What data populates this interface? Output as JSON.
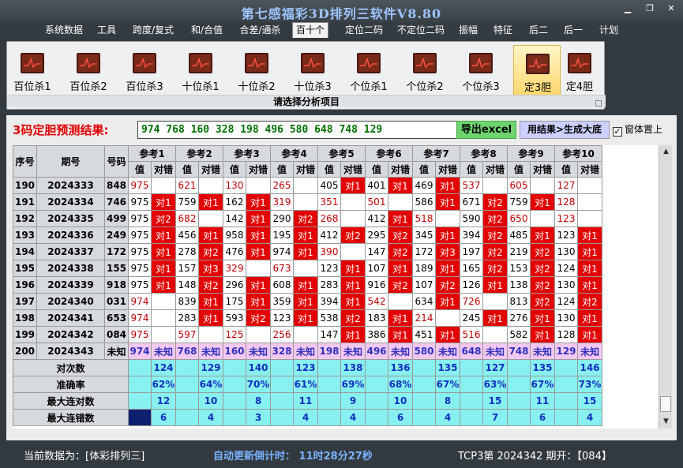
{
  "app": {
    "title": "第七感福彩3D排列三软件V8.80"
  },
  "menu": [
    "系统数据",
    "工具",
    "跨度/复式",
    "和/合值",
    "合差/通杀",
    "百十个",
    "定位二码",
    "不定位二码",
    "振幅",
    "特征",
    "后二",
    "后一",
    "计划"
  ],
  "menu_active": 5,
  "ribbon": {
    "buttons": [
      "百位杀1",
      "百位杀2",
      "百位杀3",
      "十位杀1",
      "十位杀2",
      "十位杀3",
      "个位杀1",
      "个位杀2",
      "个位杀3",
      "定3胆",
      "定4胆"
    ],
    "active": 9,
    "caption": "请选择分析项目"
  },
  "result": {
    "label": "3码定胆预测结果:",
    "value": "974  768  160  328  198  496  580  648  748  129",
    "export_label": "导出excel",
    "tobig_label": "用结果>生成大底",
    "ontop_label": "窗体置上",
    "ontop_checked": "✓"
  },
  "table": {
    "headers": {
      "seq": "序号",
      "period": "期号",
      "code": "号码",
      "ref": [
        "参考1",
        "参考2",
        "参考3",
        "参考4",
        "参考5",
        "参考6",
        "参考7",
        "参考8",
        "参考9",
        "参考10"
      ],
      "val": "值",
      "ok": "对错"
    },
    "rows": [
      {
        "seq": "190",
        "period": "2024333",
        "code": "848",
        "cells": [
          [
            "975",
            ""
          ],
          [
            "621",
            ""
          ],
          [
            "130",
            ""
          ],
          [
            "265",
            ""
          ],
          [
            "405",
            "对1"
          ],
          [
            "401",
            "对1"
          ],
          [
            "469",
            "对1"
          ],
          [
            "537",
            ""
          ],
          [
            "605",
            ""
          ],
          [
            "127",
            ""
          ]
        ]
      },
      {
        "seq": "191",
        "period": "2024334",
        "code": "746",
        "cells": [
          [
            "975",
            "对1"
          ],
          [
            "759",
            "对1"
          ],
          [
            "162",
            "对1"
          ],
          [
            "319",
            ""
          ],
          [
            "351",
            ""
          ],
          [
            "501",
            ""
          ],
          [
            "586",
            "对1"
          ],
          [
            "671",
            "对2"
          ],
          [
            "759",
            "对1"
          ],
          [
            "128",
            ""
          ]
        ]
      },
      {
        "seq": "192",
        "period": "2024335",
        "code": "499",
        "cells": [
          [
            "975",
            "对2"
          ],
          [
            "682",
            ""
          ],
          [
            "142",
            "对1"
          ],
          [
            "290",
            "对2"
          ],
          [
            "268",
            ""
          ],
          [
            "412",
            "对1"
          ],
          [
            "518",
            ""
          ],
          [
            "590",
            "对2"
          ],
          [
            "650",
            ""
          ],
          [
            "123",
            ""
          ]
        ]
      },
      {
        "seq": "193",
        "period": "2024336",
        "code": "249",
        "cells": [
          [
            "975",
            "对1"
          ],
          [
            "456",
            "对1"
          ],
          [
            "958",
            "对1"
          ],
          [
            "195",
            "对1"
          ],
          [
            "412",
            "对2"
          ],
          [
            "295",
            "对2"
          ],
          [
            "345",
            "对1"
          ],
          [
            "394",
            "对2"
          ],
          [
            "485",
            "对1"
          ],
          [
            "123",
            "对1"
          ]
        ]
      },
      {
        "seq": "194",
        "period": "2024337",
        "code": "172",
        "cells": [
          [
            "975",
            "对1"
          ],
          [
            "278",
            "对2"
          ],
          [
            "476",
            "对1"
          ],
          [
            "974",
            "对1"
          ],
          [
            "390",
            ""
          ],
          [
            "147",
            "对2"
          ],
          [
            "172",
            "对3"
          ],
          [
            "197",
            "对2"
          ],
          [
            "219",
            "对2"
          ],
          [
            "130",
            "对1"
          ]
        ]
      },
      {
        "seq": "195",
        "period": "2024338",
        "code": "155",
        "cells": [
          [
            "975",
            "对1"
          ],
          [
            "157",
            "对3"
          ],
          [
            "329",
            ""
          ],
          [
            "673",
            ""
          ],
          [
            "123",
            "对1"
          ],
          [
            "107",
            "对1"
          ],
          [
            "189",
            "对1"
          ],
          [
            "165",
            "对2"
          ],
          [
            "153",
            "对2"
          ],
          [
            "124",
            "对1"
          ]
        ]
      },
      {
        "seq": "196",
        "period": "2024339",
        "code": "918",
        "cells": [
          [
            "975",
            "对1"
          ],
          [
            "148",
            "对2"
          ],
          [
            "296",
            "对1"
          ],
          [
            "608",
            "对1"
          ],
          [
            "283",
            "对1"
          ],
          [
            "916",
            "对2"
          ],
          [
            "107",
            "对2"
          ],
          [
            "126",
            "对1"
          ],
          [
            "138",
            "对2"
          ],
          [
            "130",
            "对1"
          ]
        ]
      },
      {
        "seq": "197",
        "period": "2024340",
        "code": "031",
        "cells": [
          [
            "974",
            ""
          ],
          [
            "839",
            "对1"
          ],
          [
            "175",
            "对1"
          ],
          [
            "359",
            "对1"
          ],
          [
            "394",
            "对1"
          ],
          [
            "542",
            ""
          ],
          [
            "634",
            "对1"
          ],
          [
            "726",
            ""
          ],
          [
            "813",
            "对2"
          ],
          [
            "124",
            "对2"
          ]
        ]
      },
      {
        "seq": "198",
        "period": "2024341",
        "code": "653",
        "cells": [
          [
            "974",
            ""
          ],
          [
            "283",
            "对1"
          ],
          [
            "593",
            "对2"
          ],
          [
            "123",
            "对1"
          ],
          [
            "538",
            "对2"
          ],
          [
            "183",
            "对1"
          ],
          [
            "214",
            ""
          ],
          [
            "245",
            "对1"
          ],
          [
            "276",
            "对1"
          ],
          [
            "130",
            "对1"
          ]
        ]
      },
      {
        "seq": "199",
        "period": "2024342",
        "code": "084",
        "cells": [
          [
            "975",
            ""
          ],
          [
            "597",
            ""
          ],
          [
            "125",
            ""
          ],
          [
            "256",
            ""
          ],
          [
            "147",
            "对1"
          ],
          [
            "386",
            "对1"
          ],
          [
            "451",
            "对1"
          ],
          [
            "516",
            ""
          ],
          [
            "582",
            "对1"
          ],
          [
            "128",
            "对1"
          ]
        ]
      }
    ],
    "future": {
      "seq": "200",
      "period": "2024343",
      "code": "未知",
      "vals": [
        "974",
        "768",
        "160",
        "328",
        "198",
        "496",
        "580",
        "648",
        "748",
        "129"
      ],
      "unknown": "未知"
    },
    "stats": [
      {
        "label": "对次数",
        "vals": [
          "124",
          "129",
          "140",
          "123",
          "138",
          "136",
          "135",
          "127",
          "135",
          "146"
        ]
      },
      {
        "label": "准确率",
        "vals": [
          "62%",
          "64%",
          "70%",
          "61%",
          "69%",
          "68%",
          "67%",
          "63%",
          "67%",
          "73%"
        ]
      },
      {
        "label": "最大连对数",
        "vals": [
          "12",
          "10",
          "8",
          "11",
          "9",
          "10",
          "8",
          "15",
          "11",
          "15"
        ]
      },
      {
        "label": "最大连错数",
        "vals": [
          "6",
          "4",
          "3",
          "4",
          "4",
          "6",
          "4",
          "7",
          "6",
          "4"
        ]
      }
    ]
  },
  "status": {
    "data_source": "当前数据为：[体彩排列三]",
    "countdown": "自动更新倒计时： 11时28分27秒",
    "issue": "TCP3第 2024342 期开：【084】"
  }
}
